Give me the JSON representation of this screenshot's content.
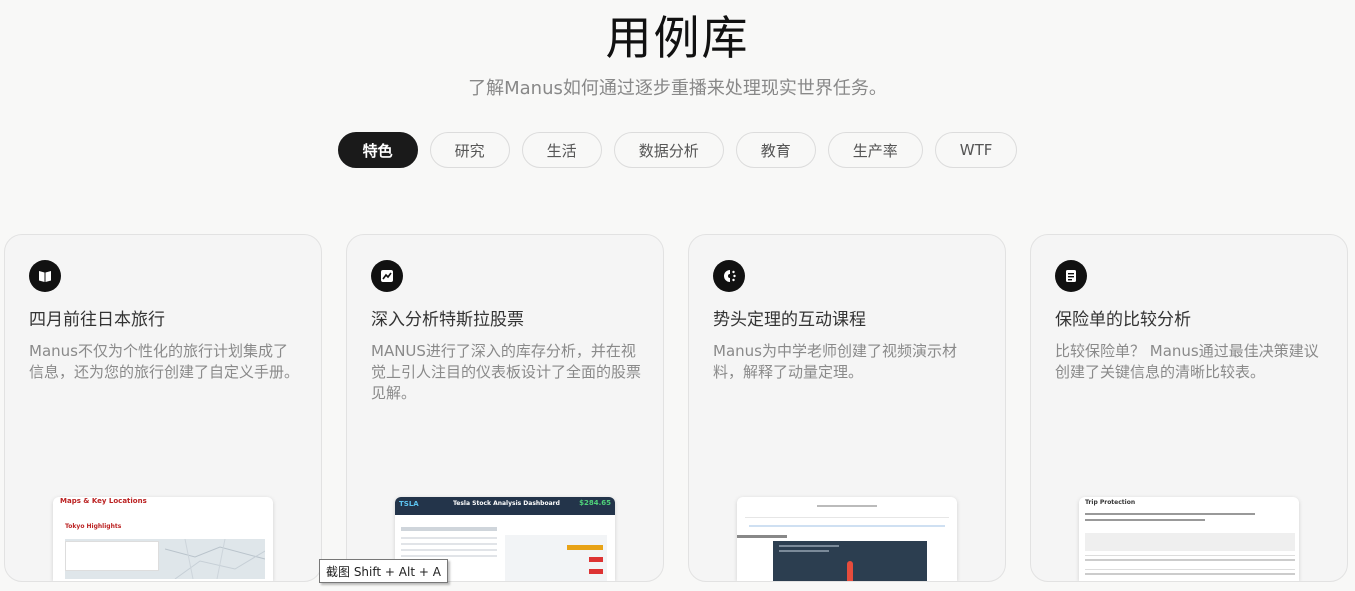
{
  "header": {
    "title": "用例库",
    "subtitle": "了解Manus如何通过逐步重播来处理现实世界任务。"
  },
  "tabs": [
    {
      "label": "特色",
      "active": true
    },
    {
      "label": "研究"
    },
    {
      "label": "生活"
    },
    {
      "label": "数据分析"
    },
    {
      "label": "教育"
    },
    {
      "label": "生产率"
    },
    {
      "label": "WTF"
    }
  ],
  "cards": [
    {
      "icon": "book-icon",
      "title": "四月前往日本旅行",
      "desc": "Manus不仅为个性化的旅行计划集成了信息，还为您的旅行创建了自定义手册。",
      "thumb": {
        "title": "Maps & Key Locations",
        "sub": "Tokyo Highlights"
      }
    },
    {
      "icon": "chart-icon",
      "title": "深入分析特斯拉股票",
      "desc": "MANUS进行了深入的库存分析，并在视觉上引人注目的仪表板设计了全面的股票见解。",
      "thumb": {
        "ticker": "TSLA",
        "title": "Tesla Stock Analysis Dashboard",
        "price": "$284.65"
      }
    },
    {
      "icon": "momentum-icon",
      "title": "势头定理的互动课程",
      "desc": "Manus为中学老师创建了视频演示材料，解释了动量定理。"
    },
    {
      "icon": "document-icon",
      "title": "保险单的比较分析",
      "desc": "比较保险单？ Manus通过最佳决策建议创建了关键信息的清晰比较表。",
      "thumb": {
        "title": "Trip Protection"
      }
    }
  ],
  "tooltip": {
    "text": "截图 Shift + Alt + A"
  },
  "colors": {
    "accent_dark": "#1a1a1a",
    "background": "#f8f8f7",
    "card": "#f5f5f5"
  }
}
